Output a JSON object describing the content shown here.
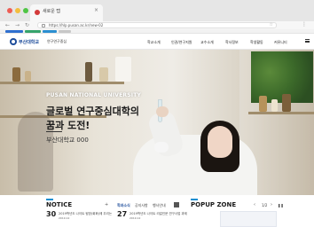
{
  "browser": {
    "tab_title": "새로운 탭",
    "tab_close": "×",
    "url": "https://hlp.pusan.ac.kr/new-02",
    "nav_back": "←",
    "nav_forward": "→",
    "nav_reload": "↻",
    "star": "☆",
    "menu": "⋮"
  },
  "site": {
    "logo_name": "부산대학교",
    "logo_sub": "연구연구중심",
    "menu": [
      "학교소개",
      "인권/연구지원",
      "교수소개",
      "학사정보",
      "학생활동",
      "커뮤니티"
    ]
  },
  "hero": {
    "kicker": "PUSAN NATIONAL UNIVERSITY",
    "title_line1": "글로벌 연구중심대학의",
    "title_line2": "꿈과 도전!",
    "caption": "부산대학교 000"
  },
  "notice": {
    "title": "NOTICE",
    "more": "+",
    "items": [
      {
        "day": "30",
        "month": "2019.12",
        "text": "2019학년도 나이트 탐방(회화)에 우리는"
      },
      {
        "day": "27",
        "month": "2019.12",
        "text": "2019학년도 나이트 리걸인문 연구사업 과제"
      }
    ]
  },
  "center_tabs": [
    "학과소식",
    "공지사항",
    "행사안내"
  ],
  "popup": {
    "title": "POPUP ZONE",
    "prev": "‹",
    "next": "›",
    "pause": "❚❚",
    "counter": "1/2"
  },
  "icons": {
    "lock": "lock-icon",
    "star": "bookmark-star-icon",
    "hamburger": "menu-icon",
    "grid": "grid-icon"
  },
  "colors": {
    "brand_blue": "#1d4c9a",
    "accent_cyan": "#1d8fd0"
  }
}
